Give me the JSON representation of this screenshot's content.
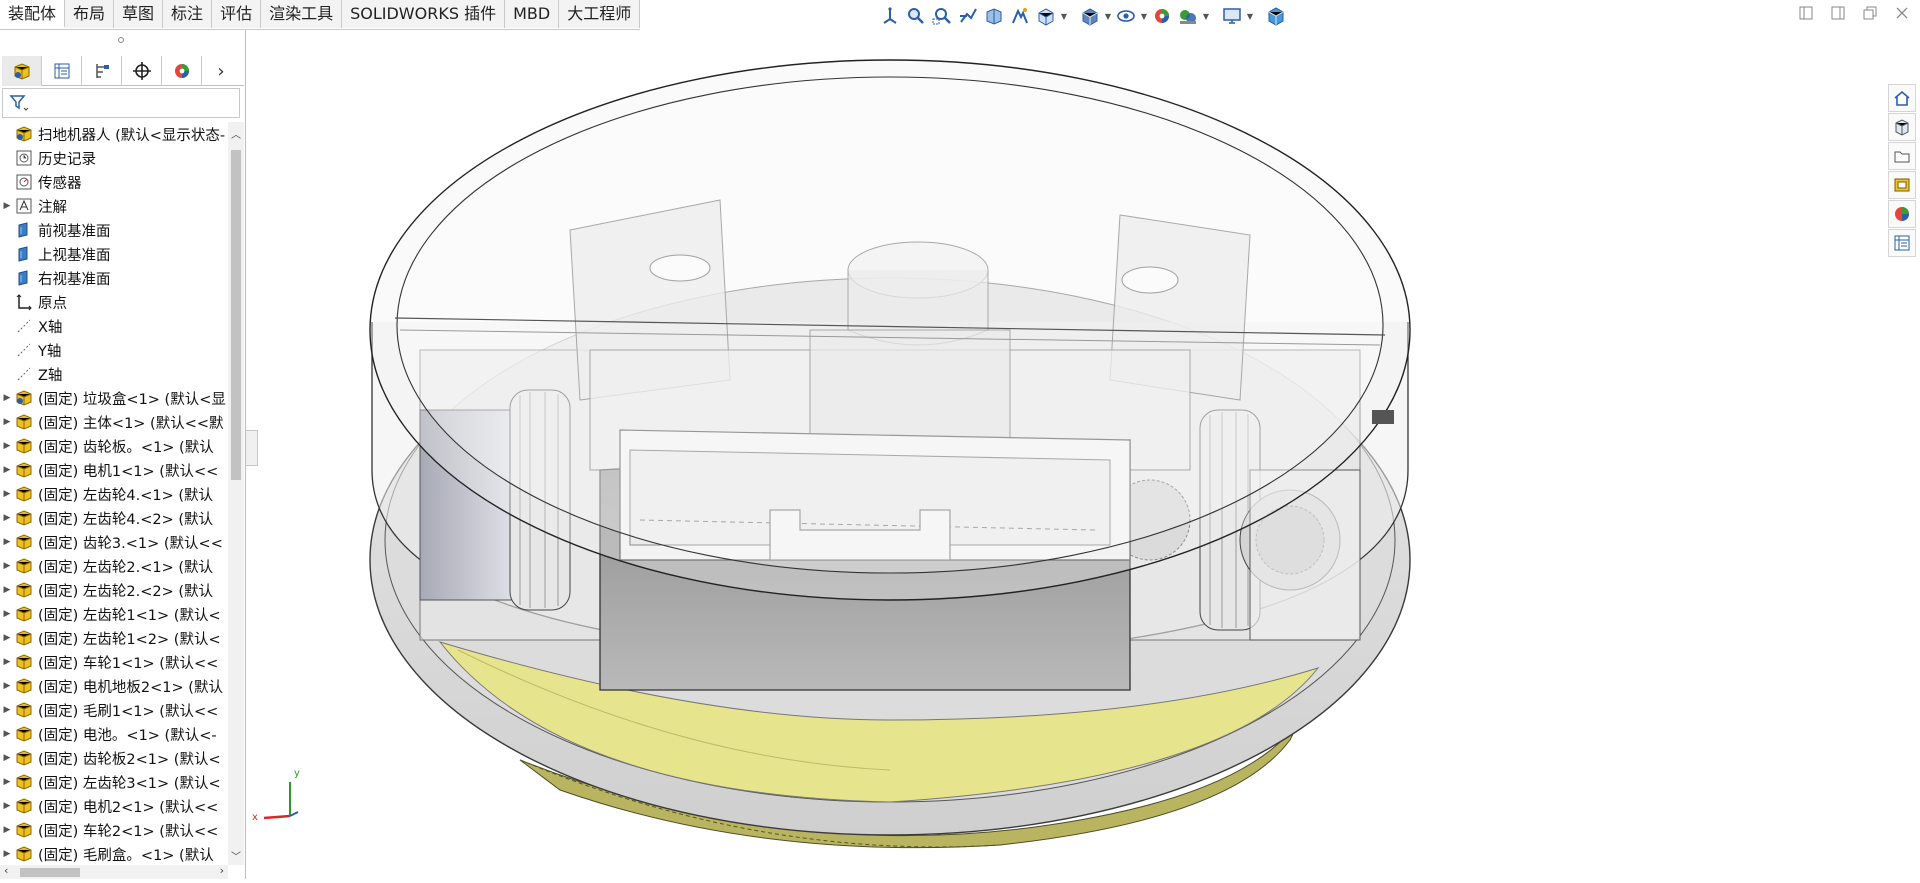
{
  "tabs": [
    {
      "label": "装配体",
      "active": true
    },
    {
      "label": "布局",
      "active": false
    },
    {
      "label": "草图",
      "active": false
    },
    {
      "label": "标注",
      "active": false
    },
    {
      "label": "评估",
      "active": false
    },
    {
      "label": "渲染工具",
      "active": false
    },
    {
      "label": "SOLIDWORKS 插件",
      "active": false
    },
    {
      "label": "MBD",
      "active": false
    },
    {
      "label": "大工程师",
      "active": false
    }
  ],
  "view_toolbar": [
    "view-orientation-icon",
    "zoom-to-fit-icon",
    "zoom-to-area-icon",
    "previous-view-icon",
    "section-view-icon",
    "dynamic-annotation-icon",
    "view-orientation-box-icon",
    "display-style-icon",
    "hide-show-items-icon",
    "edit-appearance-icon",
    "apply-scene-icon",
    "view-settings-icon",
    "3d-box-icon"
  ],
  "tree": {
    "root": "扫地机器人 (默认<显示状态-",
    "items": [
      {
        "label": "历史记录",
        "icon": "history-icon",
        "expandable": false
      },
      {
        "label": "传感器",
        "icon": "sensor-icon",
        "expandable": false
      },
      {
        "label": "注解",
        "icon": "annotation-icon",
        "expandable": true
      },
      {
        "label": "前视基准面",
        "icon": "plane-icon",
        "expandable": false
      },
      {
        "label": "上视基准面",
        "icon": "plane-icon",
        "expandable": false
      },
      {
        "label": "右视基准面",
        "icon": "plane-icon",
        "expandable": false
      },
      {
        "label": "原点",
        "icon": "origin-icon",
        "expandable": false
      },
      {
        "label": "X轴",
        "icon": "axis-icon",
        "expandable": false
      },
      {
        "label": "Y轴",
        "icon": "axis-icon",
        "expandable": false
      },
      {
        "label": "Z轴",
        "icon": "axis-icon",
        "expandable": false
      },
      {
        "label": "(固定) 垃圾盒<1> (默认<显",
        "icon": "subassembly-icon",
        "expandable": true
      },
      {
        "label": "(固定) 主体<1> (默认<<默",
        "icon": "part-icon",
        "expandable": true
      },
      {
        "label": "(固定) 齿轮板。<1> (默认",
        "icon": "part-icon",
        "expandable": true
      },
      {
        "label": "(固定) 电机1<1> (默认<<",
        "icon": "part-icon",
        "expandable": true
      },
      {
        "label": "(固定) 左齿轮4.<1> (默认",
        "icon": "part-icon",
        "expandable": true
      },
      {
        "label": "(固定) 左齿轮4.<2> (默认",
        "icon": "part-icon",
        "expandable": true
      },
      {
        "label": "(固定) 齿轮3.<1> (默认<<",
        "icon": "part-icon",
        "expandable": true
      },
      {
        "label": "(固定) 左齿轮2.<1> (默认",
        "icon": "part-icon",
        "expandable": true
      },
      {
        "label": "(固定) 左齿轮2.<2> (默认",
        "icon": "part-icon",
        "expandable": true
      },
      {
        "label": "(固定) 左齿轮1<1> (默认<",
        "icon": "part-icon",
        "expandable": true
      },
      {
        "label": "(固定) 左齿轮1<2> (默认<",
        "icon": "part-icon",
        "expandable": true
      },
      {
        "label": "(固定) 车轮1<1> (默认<<",
        "icon": "part-icon",
        "expandable": true
      },
      {
        "label": "(固定) 电机地板2<1> (默认",
        "icon": "part-icon",
        "expandable": true
      },
      {
        "label": "(固定) 毛刷1<1> (默认<<",
        "icon": "part-icon",
        "expandable": true
      },
      {
        "label": "(固定) 电池。<1> (默认<-",
        "icon": "part-icon",
        "expandable": true
      },
      {
        "label": "(固定) 齿轮板2<1> (默认<",
        "icon": "part-icon",
        "expandable": true
      },
      {
        "label": "(固定) 左齿轮3<1> (默认<",
        "icon": "part-icon",
        "expandable": true
      },
      {
        "label": "(固定) 电机2<1> (默认<<",
        "icon": "part-icon",
        "expandable": true
      },
      {
        "label": "(固定) 车轮2<1> (默认<<",
        "icon": "part-icon",
        "expandable": true
      },
      {
        "label": "(固定) 毛刷盒。<1> (默认",
        "icon": "part-icon",
        "expandable": true
      }
    ]
  },
  "taskpane": [
    "home-icon",
    "design-library-icon",
    "file-explorer-icon",
    "view-palette-icon",
    "appearances-icon",
    "custom-properties-icon"
  ],
  "triad": {
    "x_label": "x",
    "y_label": "y"
  },
  "colors": {
    "part_yellow": "#f0c020",
    "plane_blue": "#3a7fc4",
    "floor_yellow": "#e6e48c"
  }
}
